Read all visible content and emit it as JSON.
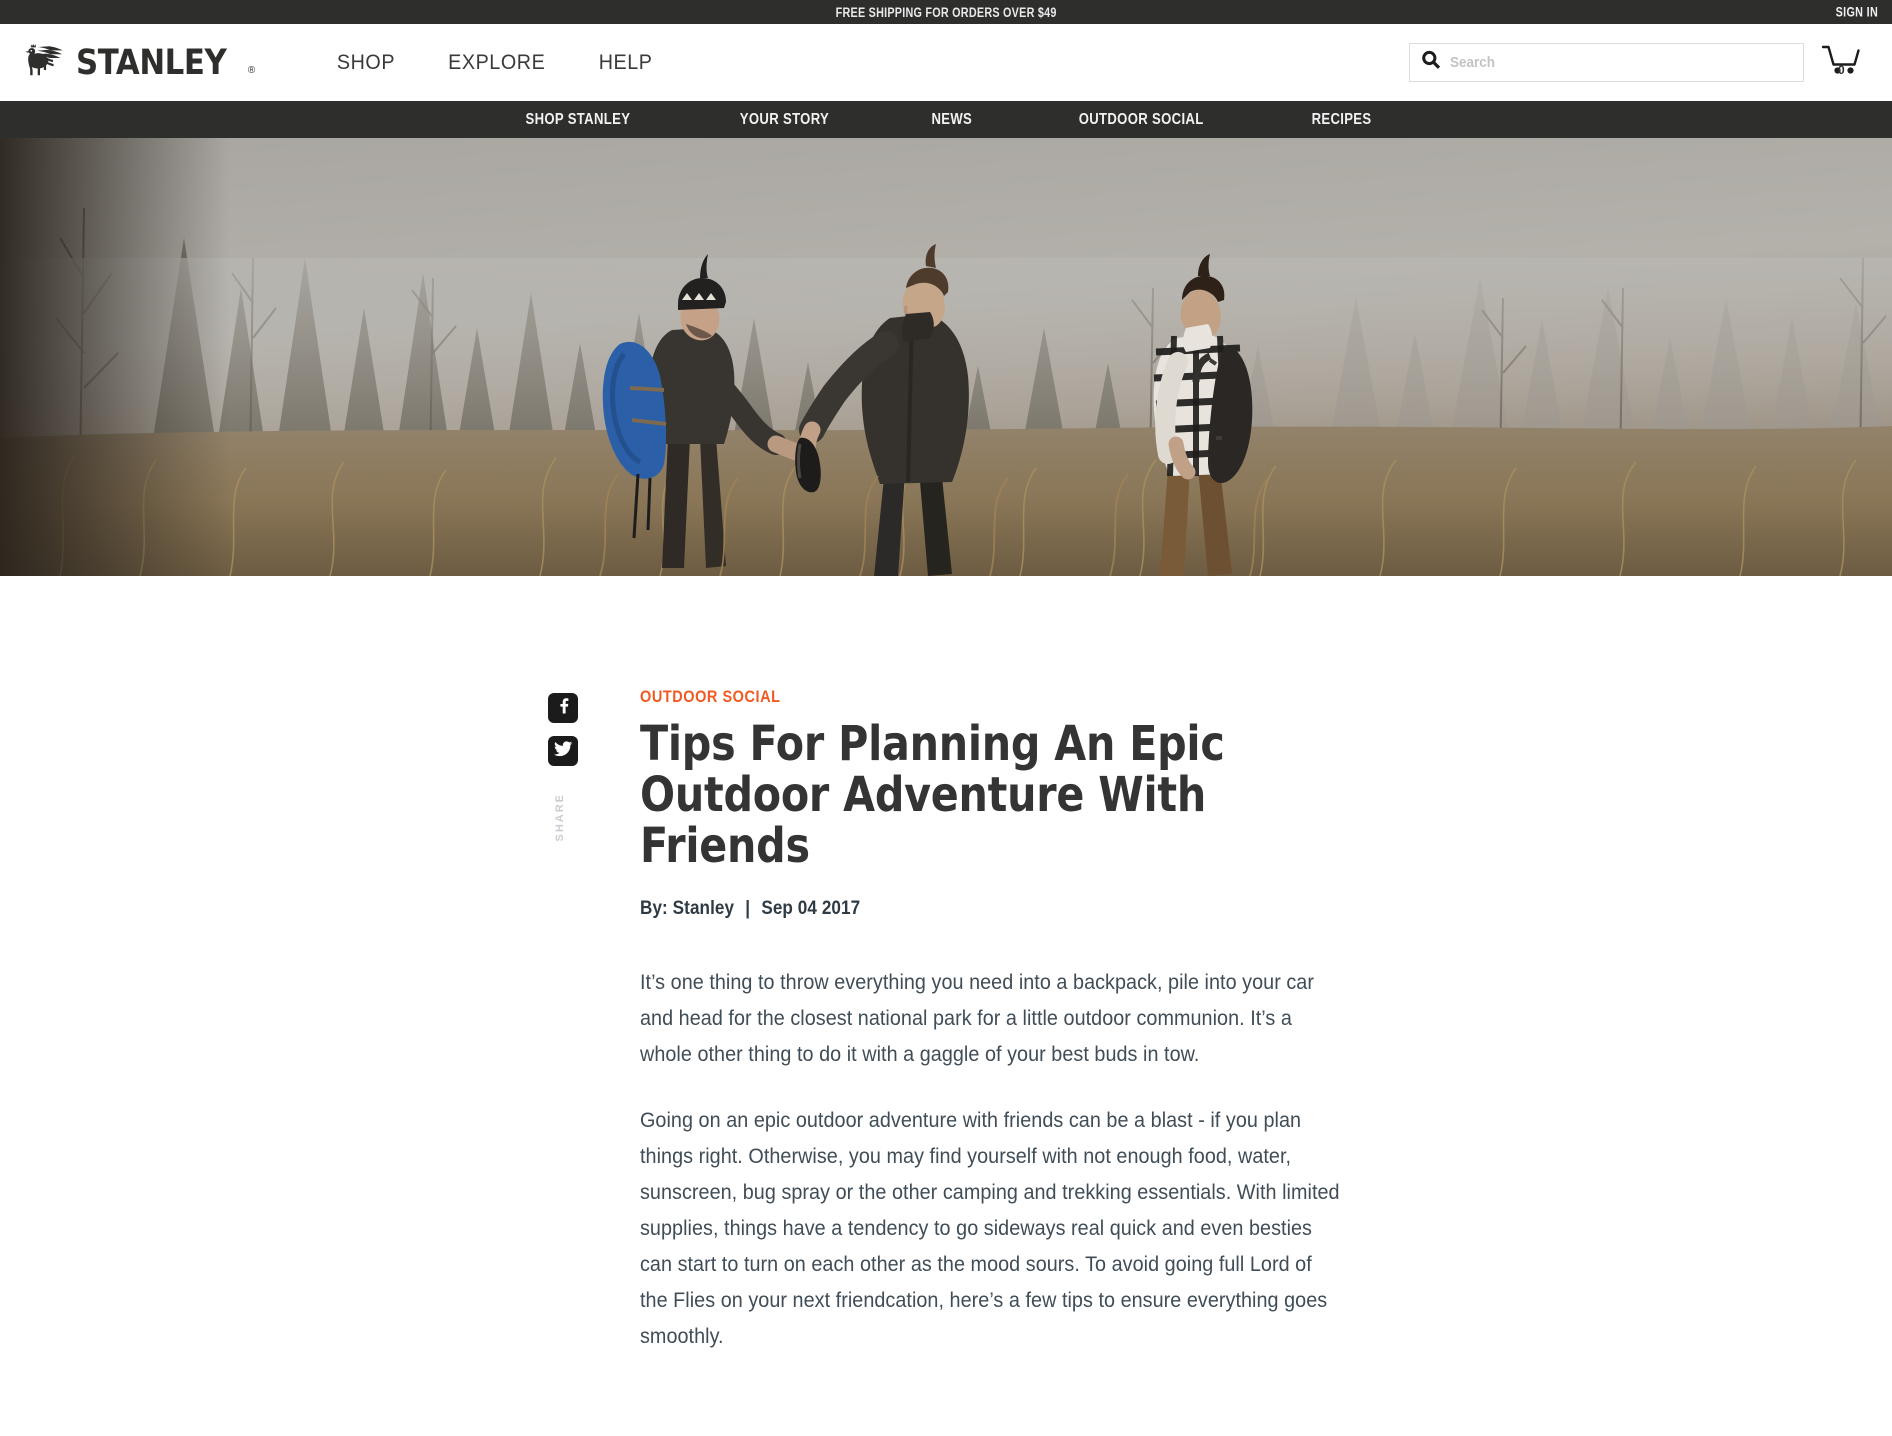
{
  "announcement": {
    "text": "FREE SHIPPING FOR ORDERS OVER $49",
    "sign_in": "SIGN IN"
  },
  "brand": {
    "name": "STANLEY",
    "trademark": "®",
    "logo_icon": "winged-griffin-icon"
  },
  "top_nav": [
    {
      "label": "SHOP"
    },
    {
      "label": "EXPLORE"
    },
    {
      "label": "HELP"
    }
  ],
  "search": {
    "value": "",
    "placeholder": "Search",
    "icon": "search-icon"
  },
  "cart": {
    "count": "0",
    "icon": "shopping-cart-icon"
  },
  "sub_nav": [
    {
      "label": "SHOP STANLEY"
    },
    {
      "label": "YOUR STORY"
    },
    {
      "label": "NEWS"
    },
    {
      "label": "OUTDOOR SOCIAL"
    },
    {
      "label": "RECIPES"
    }
  ],
  "hero": {
    "alt": "Three men hiking through a foggy forest meadow, one handing a thermos to another"
  },
  "share": {
    "label": "SHARE",
    "facebook_icon": "facebook-icon",
    "twitter_icon": "twitter-icon"
  },
  "article": {
    "category": "OUTDOOR SOCIAL",
    "title": "Tips For Planning An Epic Outdoor Adventure With Friends",
    "author": "By: Stanley",
    "separator": "|",
    "date": "Sep 04 2017",
    "paragraphs": [
      "It’s one thing to throw everything you need into a backpack, pile into your car and head for the closest national park for a little outdoor communion. It’s a whole other thing to do it with a gaggle of your best buds in tow.",
      "Going on an epic outdoor adventure with friends can be a blast - if you plan things right. Otherwise, you may find yourself with not enough food, water, sunscreen, bug spray or the other camping and trekking essentials. With limited supplies, things have a tendency to go sideways real quick and even besties can start to turn on each other as the mood sours. To avoid going full Lord of the Flies on your next friendcation, here’s a few tips to ensure everything goes smoothly."
    ]
  },
  "colors": {
    "bar_dark": "#2e2e2d",
    "accent_orange": "#f15a22",
    "title_gray": "#343434",
    "body_slate": "#404d57"
  }
}
